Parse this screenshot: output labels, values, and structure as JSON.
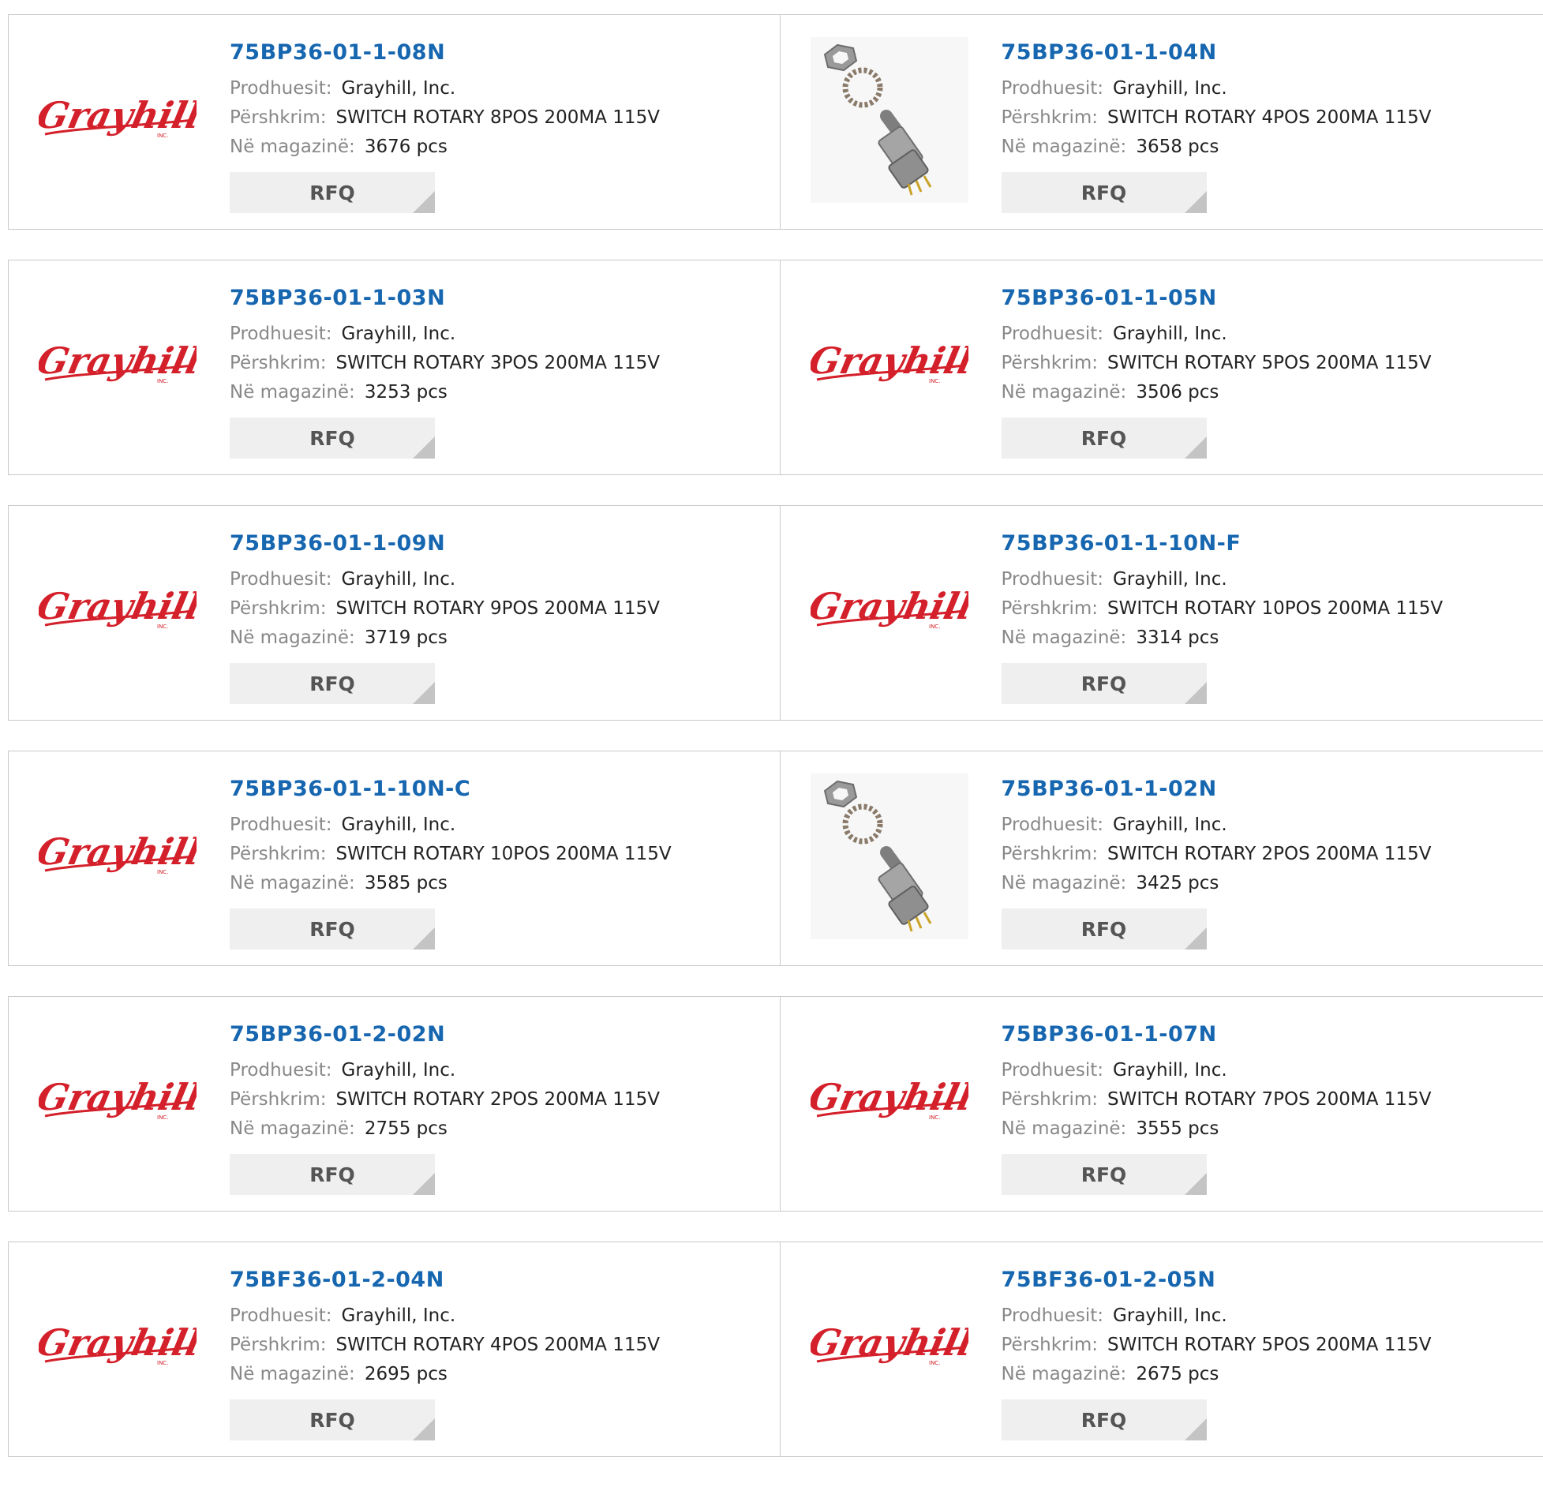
{
  "labels": {
    "manufacturer": "Prodhuesit:",
    "description": "Përshkrim:",
    "stock": "Në magazinë:",
    "rfq": "RFQ"
  },
  "products": [
    {
      "part": "75BP36-01-1-08N",
      "manufacturer": "Grayhill, Inc.",
      "description": "SWITCH ROTARY 8POS 200MA 115V",
      "stock": "3676 pcs",
      "image": "grayhill-logo"
    },
    {
      "part": "75BP36-01-1-04N",
      "manufacturer": "Grayhill, Inc.",
      "description": "SWITCH ROTARY 4POS 200MA 115V",
      "stock": "3658 pcs",
      "image": "rotary-switch-photo"
    },
    {
      "part": "75BP36-01-1-03N",
      "manufacturer": "Grayhill, Inc.",
      "description": "SWITCH ROTARY 3POS 200MA 115V",
      "stock": "3253 pcs",
      "image": "grayhill-logo"
    },
    {
      "part": "75BP36-01-1-05N",
      "manufacturer": "Grayhill, Inc.",
      "description": "SWITCH ROTARY 5POS 200MA 115V",
      "stock": "3506 pcs",
      "image": "grayhill-logo"
    },
    {
      "part": "75BP36-01-1-09N",
      "manufacturer": "Grayhill, Inc.",
      "description": "SWITCH ROTARY 9POS 200MA 115V",
      "stock": "3719 pcs",
      "image": "grayhill-logo"
    },
    {
      "part": "75BP36-01-1-10N-F",
      "manufacturer": "Grayhill, Inc.",
      "description": "SWITCH ROTARY 10POS 200MA 115V",
      "stock": "3314 pcs",
      "image": "grayhill-logo"
    },
    {
      "part": "75BP36-01-1-10N-C",
      "manufacturer": "Grayhill, Inc.",
      "description": "SWITCH ROTARY 10POS 200MA 115V",
      "stock": "3585 pcs",
      "image": "grayhill-logo"
    },
    {
      "part": "75BP36-01-1-02N",
      "manufacturer": "Grayhill, Inc.",
      "description": "SWITCH ROTARY 2POS 200MA 115V",
      "stock": "3425 pcs",
      "image": "rotary-switch-photo"
    },
    {
      "part": "75BP36-01-2-02N",
      "manufacturer": "Grayhill, Inc.",
      "description": "SWITCH ROTARY 2POS 200MA 115V",
      "stock": "2755 pcs",
      "image": "grayhill-logo"
    },
    {
      "part": "75BP36-01-1-07N",
      "manufacturer": "Grayhill, Inc.",
      "description": "SWITCH ROTARY 7POS 200MA 115V",
      "stock": "3555 pcs",
      "image": "grayhill-logo"
    },
    {
      "part": "75BF36-01-2-04N",
      "manufacturer": "Grayhill, Inc.",
      "description": "SWITCH ROTARY 4POS 200MA 115V",
      "stock": "2695 pcs",
      "image": "grayhill-logo"
    },
    {
      "part": "75BF36-01-2-05N",
      "manufacturer": "Grayhill, Inc.",
      "description": "SWITCH ROTARY 5POS 200MA 115V",
      "stock": "2675 pcs",
      "image": "grayhill-logo"
    }
  ],
  "logo": {
    "text": "Grayhill",
    "sub": "INC.",
    "color": "#d4202a"
  },
  "colors": {
    "link": "#1666b0",
    "label": "#888888",
    "value": "#222222",
    "button_bg": "#efefef",
    "border": "#c9c9c9"
  }
}
